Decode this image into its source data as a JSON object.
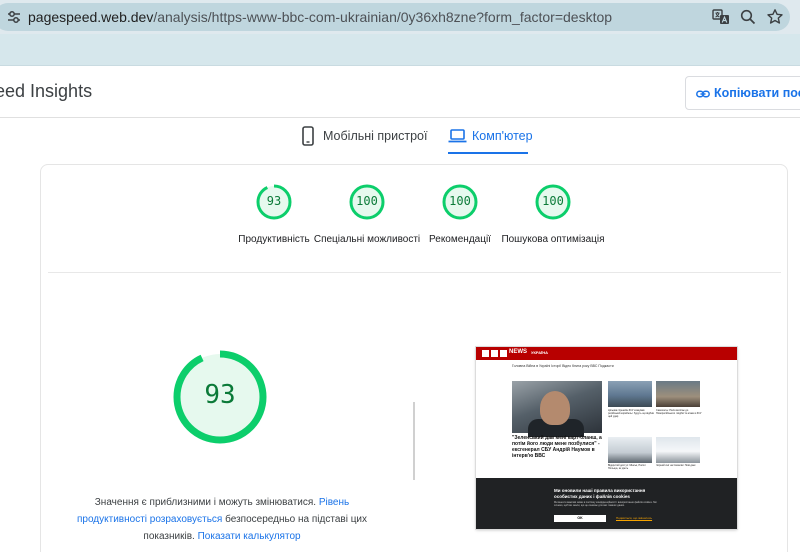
{
  "browser": {
    "url_host": "pagespeed.web.dev",
    "url_rest": "/analysis/https-www-bbc-com-ukrainian/0y36xh8zne?form_factor=desktop",
    "icons": [
      "tune-icon",
      "translate-icon",
      "zoom-icon",
      "bookmark-star-icon"
    ]
  },
  "header": {
    "title": "eed Insights",
    "copy_link_label": "Копіювати посил"
  },
  "tabs": [
    {
      "label": "Мобільні пристрої",
      "icon": "smartphone-icon",
      "selected": false
    },
    {
      "label": "Комп'ютер",
      "icon": "laptop-icon",
      "selected": true
    }
  ],
  "categories": [
    {
      "score": "93",
      "score_value": 93,
      "label": "Продуктивність"
    },
    {
      "score": "100",
      "score_value": 100,
      "label": "Спеціальні можливості"
    },
    {
      "score": "100",
      "score_value": 100,
      "label": "Рекомендації"
    },
    {
      "score": "100",
      "score_value": 100,
      "label": "Пошукова оптимізація"
    }
  ],
  "performance": {
    "score": "93",
    "score_value": 93,
    "note_prefix": "Значення є приблизними і можуть змінюватися. ",
    "note_link1": "Рівень продуктивності розраховується",
    "note_middle": " безпосередньо на підставі цих показників. ",
    "note_link2": "Показати калькулятор"
  },
  "screenshot": {
    "brand": "NEWS",
    "edition": "УКРАЇНА",
    "nav": "Головна    Війна в Україні    Історії    Відео    Книга року ВВС    Подкасти",
    "headline": "\"Зеленський дав мені карт-бланш, а потім його люди мене позбулися\" - ексгенерал СБУ Андрій Наумов в інтерв'ю ВВС",
    "story2": "Цільова: Кремлін ЗСУ атакував російський корабель і будуть що відбив цей удар",
    "story3": "Самолеты: Росія вилітає до Новоросійського і відбиття атаки в ЗСУ",
    "story4": "Відкритий доступ: Мінськ, Росія і Польща, як діють",
    "story5": "Чорний сніг на Сахаліні: Нові дані",
    "cookie_title": "Ми оновили наші правила використання особистих даних і файлів cookies",
    "cookie_body": "Ми внесли важливі зміни в політику конфіденційності і використання файлів cookies. Ми хочемо, щоб ви знали, що це означає для вас і ваших даних.",
    "cookie_ok": "OK",
    "cookie_more": "Подивіться, що змінилось"
  },
  "colors": {
    "pass_green": "#0cce6b",
    "pass_text": "#0b7a38",
    "pass_fill": "#e6f9ee",
    "link_blue": "#1a73e8",
    "bbc_red": "#b80000"
  }
}
